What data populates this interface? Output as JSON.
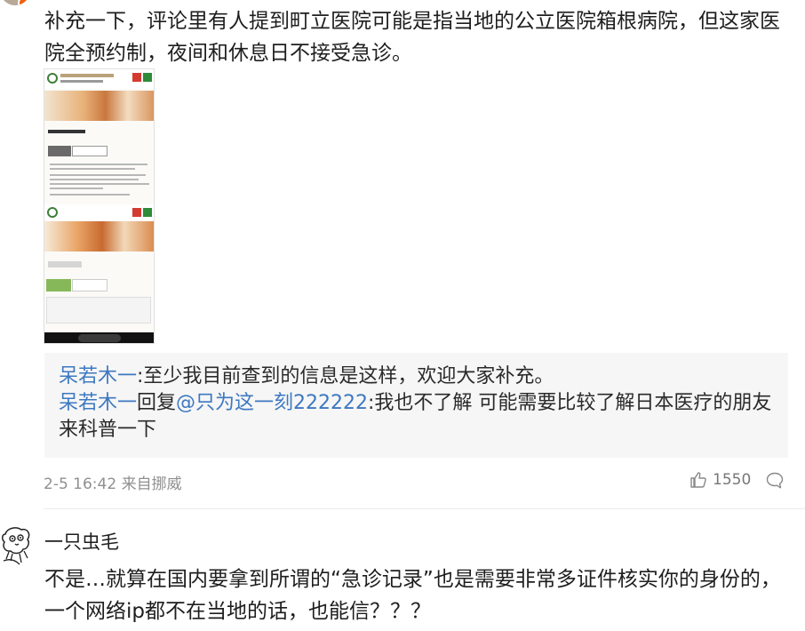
{
  "comment1": {
    "text": "补充一下，评论里有人提到町立医院可能是指当地的公立医院箱根病院，但这家医院全预约制，夜间和休息日不接受急诊。",
    "replies": [
      {
        "user": "呆若木一",
        "text": ":至少我目前查到的信息是这样，欢迎大家补充。"
      },
      {
        "user": "呆若木一",
        "connector": "回复",
        "mention": "@只为这一刻222222",
        "text": ":我也不了解 可能需要比较了解日本医疗的朋友来科普一下"
      }
    ],
    "meta": "2-5 16:42 来自挪威",
    "likes": "1550",
    "like_icon": "thumbs-up-icon",
    "comment_icon": "comment-bubble-icon"
  },
  "comment2": {
    "username": "一只虫毛",
    "text": "不是…就算在国内要拿到所谓的“急诊记录”也是需要非常多证件核实你的身份的，一个网络ip都不在当地的话，也能信？？？"
  },
  "colors": {
    "link": "#3d78c1",
    "meta": "#909090",
    "reply_bg": "#f6f6f6"
  }
}
